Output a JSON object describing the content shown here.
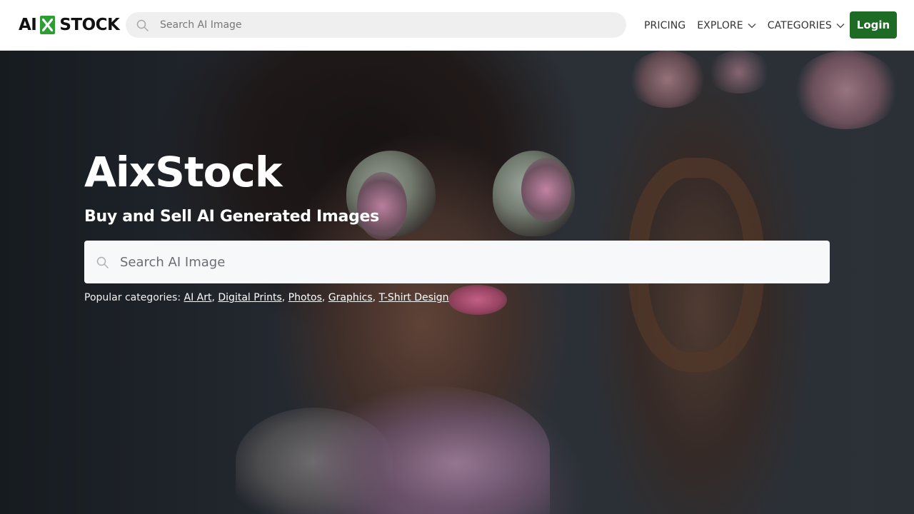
{
  "header": {
    "logo": {
      "left": "AI",
      "right": "STOCK",
      "badge_icon": "x-icon"
    },
    "search": {
      "placeholder": "Search AI Image",
      "icon": "search-icon"
    },
    "nav": [
      {
        "label": "PRICING",
        "has_dropdown": false
      },
      {
        "label": "EXPLORE",
        "has_dropdown": true
      },
      {
        "label": "CATEGORIES",
        "has_dropdown": true
      }
    ],
    "login_label": "Login"
  },
  "hero": {
    "title": "AixStock",
    "subtitle": "Buy and Sell AI Generated Images",
    "search": {
      "placeholder": "Search AI Image",
      "icon": "search-icon"
    },
    "popular_prefix": "Popular categories:",
    "popular_categories": [
      "AI Art",
      "Digital Prints",
      "Photos",
      "Graphics",
      "T-Shirt Design"
    ]
  },
  "colors": {
    "brand_green": "#2e9e34",
    "login_bg": "#1e6b25",
    "header_bg": "#ffffff",
    "search_bg": "#efefef"
  }
}
